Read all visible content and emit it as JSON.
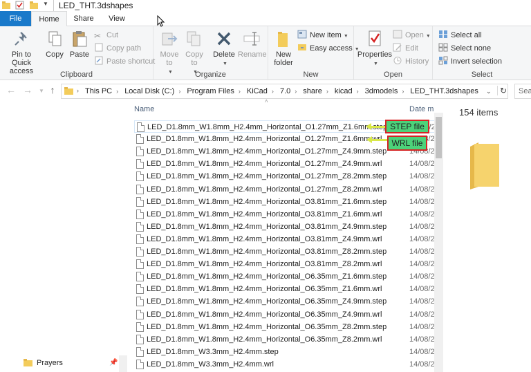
{
  "window": {
    "title": "LED_THT.3dshapes"
  },
  "tabs": {
    "file": "File",
    "home": "Home",
    "share": "Share",
    "view": "View"
  },
  "ribbon": {
    "clipboard": {
      "label": "Clipboard",
      "pin": "Pin to Quick access",
      "copy": "Copy",
      "paste": "Paste",
      "cut": "Cut",
      "copy_path": "Copy path",
      "paste_shortcut": "Paste shortcut"
    },
    "organize": {
      "label": "Organize",
      "move_to": "Move to",
      "copy_to": "Copy to",
      "delete": "Delete",
      "rename": "Rename"
    },
    "new": {
      "label": "New",
      "new_folder": "New folder",
      "new_item": "New item",
      "easy_access": "Easy access"
    },
    "open": {
      "label": "Open",
      "properties": "Properties",
      "open": "Open",
      "edit": "Edit",
      "history": "History"
    },
    "select": {
      "label": "Select",
      "select_all": "Select all",
      "select_none": "Select none",
      "invert": "Invert selection"
    }
  },
  "address": {
    "crumbs": [
      "This PC",
      "Local Disk (C:)",
      "Program Files",
      "KiCad",
      "7.0",
      "share",
      "kicad",
      "3dmodels",
      "LED_THT.3dshapes"
    ],
    "search_placeholder": "Sear"
  },
  "columns": {
    "name": "Name",
    "date": "Date m"
  },
  "files": [
    {
      "name": "LED_D1.8mm_W1.8mm_H2.4mm_Horizontal_O1.27mm_Z1.6mm.step",
      "date": "14/08/2"
    },
    {
      "name": "LED_D1.8mm_W1.8mm_H2.4mm_Horizontal_O1.27mm_Z1.6mm.wrl",
      "date": "14/08/2"
    },
    {
      "name": "LED_D1.8mm_W1.8mm_H2.4mm_Horizontal_O1.27mm_Z4.9mm.step",
      "date": "14/08/2"
    },
    {
      "name": "LED_D1.8mm_W1.8mm_H2.4mm_Horizontal_O1.27mm_Z4.9mm.wrl",
      "date": "14/08/2"
    },
    {
      "name": "LED_D1.8mm_W1.8mm_H2.4mm_Horizontal_O1.27mm_Z8.2mm.step",
      "date": "14/08/2"
    },
    {
      "name": "LED_D1.8mm_W1.8mm_H2.4mm_Horizontal_O1.27mm_Z8.2mm.wrl",
      "date": "14/08/2"
    },
    {
      "name": "LED_D1.8mm_W1.8mm_H2.4mm_Horizontal_O3.81mm_Z1.6mm.step",
      "date": "14/08/2"
    },
    {
      "name": "LED_D1.8mm_W1.8mm_H2.4mm_Horizontal_O3.81mm_Z1.6mm.wrl",
      "date": "14/08/2"
    },
    {
      "name": "LED_D1.8mm_W1.8mm_H2.4mm_Horizontal_O3.81mm_Z4.9mm.step",
      "date": "14/08/2"
    },
    {
      "name": "LED_D1.8mm_W1.8mm_H2.4mm_Horizontal_O3.81mm_Z4.9mm.wrl",
      "date": "14/08/2"
    },
    {
      "name": "LED_D1.8mm_W1.8mm_H2.4mm_Horizontal_O3.81mm_Z8.2mm.step",
      "date": "14/08/2"
    },
    {
      "name": "LED_D1.8mm_W1.8mm_H2.4mm_Horizontal_O3.81mm_Z8.2mm.wrl",
      "date": "14/08/2"
    },
    {
      "name": "LED_D1.8mm_W1.8mm_H2.4mm_Horizontal_O6.35mm_Z1.6mm.step",
      "date": "14/08/2"
    },
    {
      "name": "LED_D1.8mm_W1.8mm_H2.4mm_Horizontal_O6.35mm_Z1.6mm.wrl",
      "date": "14/08/2"
    },
    {
      "name": "LED_D1.8mm_W1.8mm_H2.4mm_Horizontal_O6.35mm_Z4.9mm.step",
      "date": "14/08/2"
    },
    {
      "name": "LED_D1.8mm_W1.8mm_H2.4mm_Horizontal_O6.35mm_Z4.9mm.wrl",
      "date": "14/08/2"
    },
    {
      "name": "LED_D1.8mm_W1.8mm_H2.4mm_Horizontal_O6.35mm_Z8.2mm.step",
      "date": "14/08/2"
    },
    {
      "name": "LED_D1.8mm_W1.8mm_H2.4mm_Horizontal_O6.35mm_Z8.2mm.wrl",
      "date": "14/08/2"
    },
    {
      "name": "LED_D1.8mm_W3.3mm_H2.4mm.step",
      "date": "14/08/2"
    },
    {
      "name": "LED_D1.8mm_W3.3mm_H2.4mm.wrl",
      "date": "14/08/2"
    }
  ],
  "annotations": {
    "step": "STEP file",
    "wrl": "WRL file"
  },
  "navpane": {
    "item": "Prayers"
  },
  "preview": {
    "count": "154 items"
  },
  "colors": {
    "accent": "#1979ca",
    "annotation_fill": "#4cd37a",
    "annotation_border": "#d62424",
    "arrow": "#d9e84a",
    "folder": "#f3cc5b"
  }
}
